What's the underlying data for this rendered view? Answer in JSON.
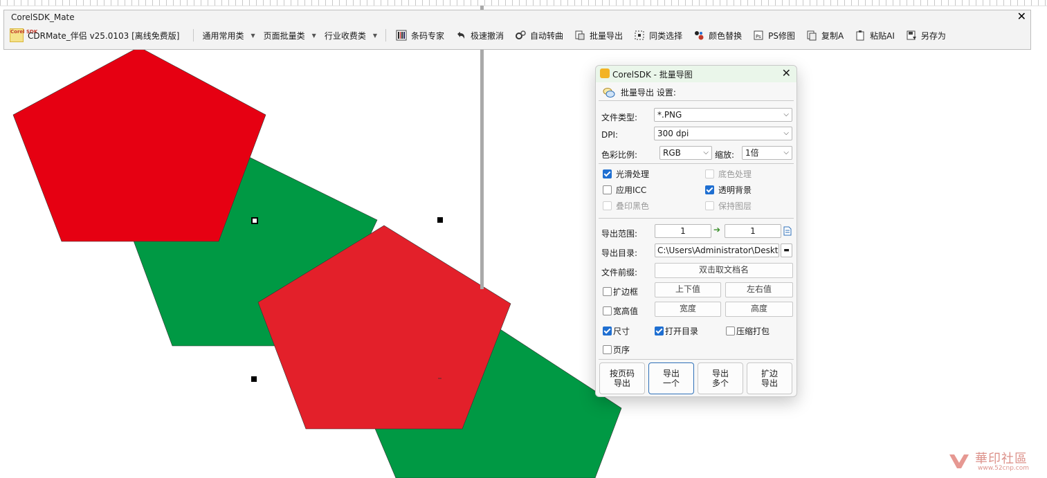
{
  "toolbar_window": {
    "title": "CorelSDK_Mate",
    "close_glyph": "✕",
    "brand_logo_text": "Corel SDK",
    "brand_label": "CDRMate_伴侣 v25.0103 [离线免费版]",
    "menus": [
      {
        "label": "通用常用类",
        "icon": "caret-down-icon"
      },
      {
        "label": "页面批量类",
        "icon": "caret-down-icon"
      },
      {
        "label": "行业收费类",
        "icon": "caret-down-icon"
      }
    ],
    "tools": [
      {
        "label": "条码专家",
        "icon": "barcode-icon"
      },
      {
        "label": "极速撤消",
        "icon": "undo-icon"
      },
      {
        "label": "自动转曲",
        "icon": "gears-icon"
      },
      {
        "label": "批量导出",
        "icon": "batch-export-icon"
      },
      {
        "label": "同类选择",
        "icon": "select-similar-icon"
      },
      {
        "label": "颜色替换",
        "icon": "color-replace-icon"
      },
      {
        "label": "PS修图",
        "icon": "ps-edit-icon"
      },
      {
        "label": "复制A",
        "icon": "copy-icon"
      },
      {
        "label": "粘贴AI",
        "icon": "paste-icon"
      },
      {
        "label": "另存为",
        "icon": "save-as-icon"
      }
    ]
  },
  "dialog": {
    "title": "CorelSDK - 批量导图",
    "section_label": "批量导出 设置:",
    "file_type_label": "文件类型:",
    "file_type_value": "*.PNG",
    "dpi_label": "DPI:",
    "dpi_value": "300 dpi",
    "color_label": "色彩比例:",
    "color_value": "RGB",
    "zoom_label": "缩放:",
    "zoom_value": "1倍",
    "options": [
      {
        "label": "光滑处理",
        "checked": true,
        "enabled": true
      },
      {
        "label": "底色处理",
        "checked": false,
        "enabled": false
      },
      {
        "label": "应用ICC",
        "checked": false,
        "enabled": true
      },
      {
        "label": "透明背景",
        "checked": true,
        "enabled": true
      },
      {
        "label": "叠印黑色",
        "checked": false,
        "enabled": false
      },
      {
        "label": "保持图层",
        "checked": false,
        "enabled": false
      }
    ],
    "range_label": "导出范围:",
    "range_from": "1",
    "range_to": "1",
    "dir_label": "导出目录:",
    "dir_value": "C:\\Users\\Administrator\\Desktop",
    "prefix_label": "文件前缀:",
    "prefix_button": "双击取文档名",
    "border_label": "扩边框",
    "border_top_bottom": "上下值",
    "border_left_right": "左右值",
    "wh_label": "宽高值",
    "width_button": "宽度",
    "height_button": "高度",
    "size_label": "尺寸",
    "open_dir_label": "打开目录",
    "zip_label": "压缩打包",
    "page_order_label": "页序",
    "buttons": [
      {
        "line1": "按页码",
        "line2": "导出"
      },
      {
        "line1": "导出",
        "line2": "一个"
      },
      {
        "line1": "导出",
        "line2": "多个"
      },
      {
        "line1": "扩边",
        "line2": "导出"
      }
    ]
  },
  "colors": {
    "red": "#e60012",
    "red2": "#e3202a",
    "green": "#009944",
    "accent_blue": "#1f6fd1"
  },
  "watermark": {
    "text": "華印社區",
    "url": "www.52cnp.com"
  }
}
